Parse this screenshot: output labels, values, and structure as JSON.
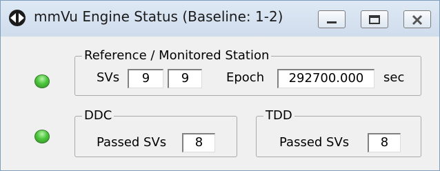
{
  "window": {
    "title": "mmVu Engine Status (Baseline: 1-2)",
    "icon": "double-arrow-icon"
  },
  "status_leds": [
    {
      "name": "reference-monitored-status",
      "color": "#4ec63e"
    },
    {
      "name": "ddc-status",
      "color": "#4ec63e"
    }
  ],
  "reference_group": {
    "legend": "Reference / Monitored Station",
    "svs_label": "SVs",
    "svs_reference": "9",
    "svs_monitored": "9",
    "epoch_label": "Epoch",
    "epoch_value": "292700.000",
    "epoch_unit": "sec"
  },
  "ddc_group": {
    "legend": "DDC",
    "passed_label": "Passed SVs",
    "passed_value": "8"
  },
  "tdd_group": {
    "legend": "TDD",
    "passed_label": "Passed SVs",
    "passed_value": "8"
  }
}
